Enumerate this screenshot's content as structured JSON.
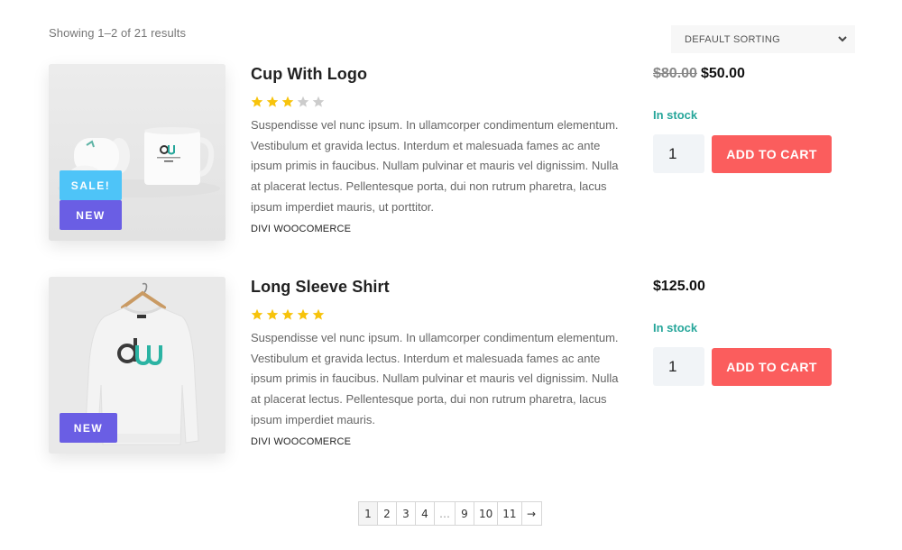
{
  "toolbar": {
    "result_count": "Showing 1–2 of 21 results",
    "sort_selected": "DEFAULT SORTING",
    "sort_icon": "chevron-down-icon"
  },
  "products": [
    {
      "title": "Cup With Logo",
      "rating": 3,
      "rating_max": 5,
      "description": "Suspendisse vel nunc ipsum. In ullamcorper condimentum elementum. Vestibulum et gravida lectus. Interdum et malesuada fames ac ante ipsum primis in faucibus. Nullam pulvinar et mauris vel dignissim. Nulla at placerat lectus. Pellentesque porta, dui non rutrum pharetra, lacus ipsum imperdiet mauris, ut porttitor.",
      "category": "DIVI WOOCOMERCE",
      "price_old": "$80.00",
      "price": "$50.00",
      "stock": "In stock",
      "quantity": "1",
      "add_to_cart": "ADD TO CART",
      "badges": [
        "SALE!",
        "NEW"
      ],
      "image": "mug-image"
    },
    {
      "title": "Long Sleeve Shirt",
      "rating": 5,
      "rating_max": 5,
      "description": "Suspendisse vel nunc ipsum. In ullamcorper condimentum elementum. Vestibulum et gravida lectus. Interdum et malesuada fames ac ante ipsum primis in faucibus. Nullam pulvinar et mauris vel dignissim. Nulla at placerat lectus. Pellentesque porta, dui non rutrum pharetra, lacus ipsum imperdiet mauris.",
      "category": "DIVI WOOCOMERCE",
      "price": "$125.00",
      "stock": "In stock",
      "quantity": "1",
      "add_to_cart": "ADD TO CART",
      "badges": [
        "NEW"
      ],
      "image": "sweatshirt-image"
    }
  ],
  "pagination": {
    "pages": [
      "1",
      "2",
      "3",
      "4",
      "…",
      "9",
      "10",
      "11",
      "→"
    ],
    "current": "1"
  },
  "colors": {
    "sale_badge": "#4ec4f8",
    "new_badge": "#6a5ee4",
    "add_to_cart": "#fb5d5d",
    "in_stock": "#26a69a",
    "star_filled": "#f7c30c",
    "star_empty": "#cccccc"
  }
}
